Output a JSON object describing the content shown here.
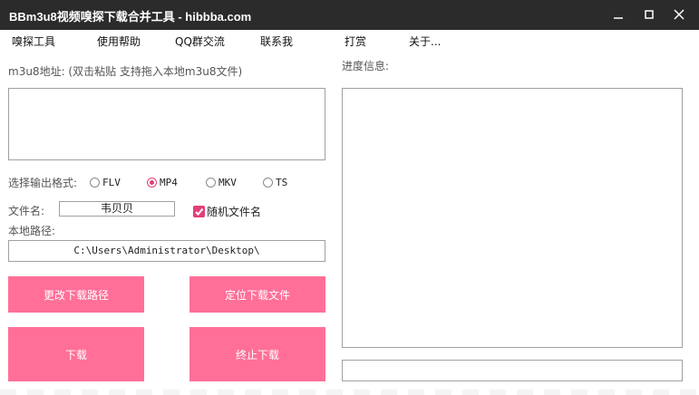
{
  "window": {
    "title": "BBm3u8视频嗅探下载合并工具 - hibbba.com"
  },
  "menu": [
    {
      "key": "sniff",
      "label": "嗅探工具"
    },
    {
      "key": "help",
      "label": "使用帮助"
    },
    {
      "key": "qq",
      "label": "QQ群交流"
    },
    {
      "key": "contact",
      "label": "联系我"
    },
    {
      "key": "tip",
      "label": "打赏"
    },
    {
      "key": "about",
      "label": "关于..."
    }
  ],
  "m3u8_label": "m3u8地址: (双击粘贴 支持拖入本地m3u8文件)",
  "m3u8_value": "",
  "progress_label": "进度信息:",
  "progress_log": "",
  "progress_status": "",
  "format": {
    "label": "选择输出格式:",
    "options": [
      "FLV",
      "MP4",
      "MKV",
      "TS"
    ],
    "selected": "MP4"
  },
  "filename": {
    "label": "文件名:",
    "value": "韦贝贝"
  },
  "random_filename": {
    "label": "随机文件名",
    "checked": true
  },
  "local_path": {
    "label": "本地路径:",
    "value": "C:\\Users\\Administrator\\Desktop\\"
  },
  "buttons": {
    "change_path": "更改下载路径",
    "locate_file": "定位下载文件",
    "download": "下载",
    "stop_download": "终止下载"
  },
  "colors": {
    "titlebar": "#2b2b2b",
    "button": "#ff6f98",
    "accent": "#e0407a"
  }
}
